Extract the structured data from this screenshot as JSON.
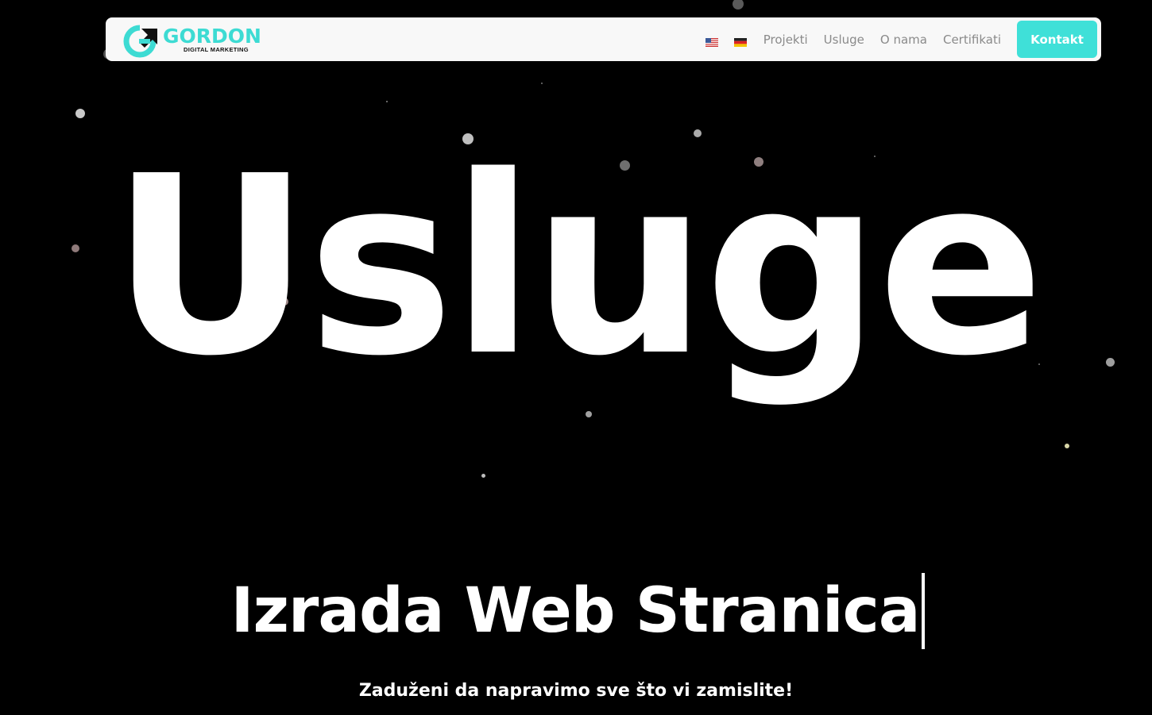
{
  "brand": {
    "name": "GORDON",
    "tagline": "DIGITAL MARKETING",
    "accent_color": "#3ddbd3",
    "icon": "gordon-logo-icon"
  },
  "nav": {
    "languages": [
      {
        "code": "en",
        "icon": "us-flag-icon"
      },
      {
        "code": "de",
        "icon": "de-flag-icon"
      }
    ],
    "links": [
      "Projekti",
      "Usluge",
      "O nama",
      "Certifikati"
    ],
    "cta_label": "Kontakt",
    "cta_color": "#3fe0d8"
  },
  "hero": {
    "title": "Usluge",
    "typed_text": "Izrada Web Stranica",
    "tagline": "Zaduženi da napravimo sve što vi zamislite!"
  },
  "colors": {
    "background": "#000000",
    "text": "#ffffff",
    "nav_link": "#8a8a8a"
  }
}
